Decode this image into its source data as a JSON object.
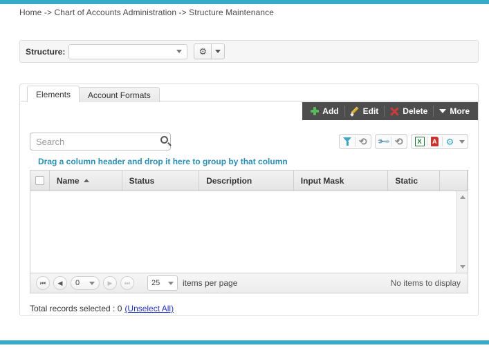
{
  "theme": {
    "accent": "#35abc8",
    "toolbar_bg": "#4d4d4d",
    "link": "#2233cc",
    "group_hint": "#2a8fb5"
  },
  "breadcrumb": {
    "text": "Home -> Chart of Accounts Administration -> Structure Maintenance"
  },
  "structure_bar": {
    "label": "Structure:",
    "combo_value": "",
    "combo_caret_icon": "chevron-down-icon",
    "settings_icon": "gear-icon",
    "settings_caret_icon": "chevron-down-icon"
  },
  "tabs": [
    {
      "label": "Elements",
      "active": true
    },
    {
      "label": "Account Formats",
      "active": false
    }
  ],
  "action_toolbar": {
    "buttons": [
      {
        "label": "Add",
        "icon": "plus-icon"
      },
      {
        "label": "Edit",
        "icon": "pencil-icon"
      },
      {
        "label": "Delete",
        "icon": "delete-x-icon"
      },
      {
        "label": "More",
        "icon": "chevron-down-icon"
      }
    ]
  },
  "grid": {
    "search": {
      "placeholder": "Search",
      "value": "",
      "icon": "search-icon"
    },
    "tool_groups": [
      {
        "icons": [
          "filter-icon",
          "refresh-icon"
        ]
      },
      {
        "icons": [
          "wrench-icon",
          "refresh-icon"
        ]
      },
      {
        "icons": [
          "excel-export-icon",
          "pdf-export-icon",
          "gear-icon",
          "chevron-down-icon"
        ]
      }
    ],
    "group_hint": "Drag a column header and drop it here to group by that column",
    "columns": [
      {
        "label": "",
        "type": "checkbox"
      },
      {
        "label": "Name",
        "sort": "asc"
      },
      {
        "label": "Status"
      },
      {
        "label": "Description"
      },
      {
        "label": "Input Mask"
      },
      {
        "label": "Static"
      },
      {
        "label": ""
      }
    ],
    "rows": [],
    "empty_message": "No items to display"
  },
  "pager": {
    "first_icon": "page-first-icon",
    "prev_icon": "page-prev-icon",
    "next_icon": "page-next-icon",
    "last_icon": "page-last-icon",
    "current_page": "0",
    "page_size": "25",
    "page_size_label": "items per page",
    "status": "No items to display"
  },
  "footer": {
    "total_label": "Total records selected : 0",
    "unselect_link": "(Unselect All)"
  }
}
